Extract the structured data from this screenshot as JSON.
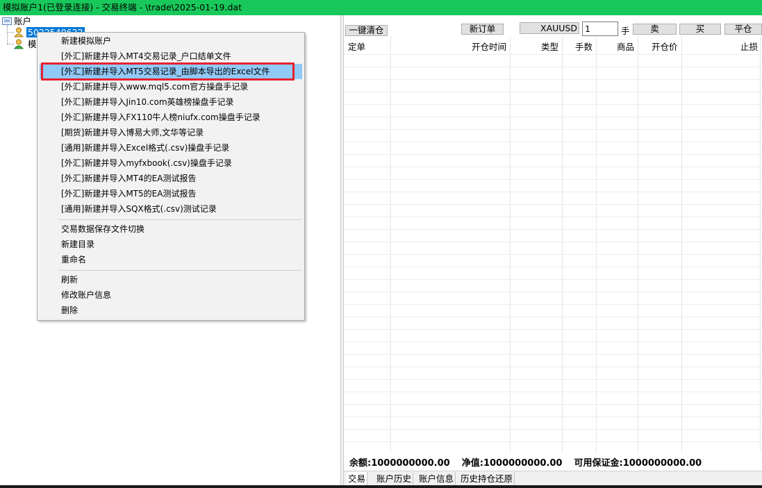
{
  "window": {
    "title": "模拟账户1(已登录连接)  - 交易终端 - \\trade\\2025-01-19.dat"
  },
  "tree": {
    "root_label": "账户",
    "account1_label": "5022540622",
    "account2_label": "模"
  },
  "context_menu": {
    "items": [
      "新建模拟账户",
      "[外汇]新建并导入MT4交易记录_户口结单文件",
      "[外汇]新建并导入MT5交易记录_由脚本导出的Excel文件",
      "[外汇]新建并导入www.mql5.com官方操盘手记录",
      "[外汇]新建并导入Jin10.com英雄榜操盘手记录",
      "[外汇]新建并导入FX110牛人榜niufx.com操盘手记录",
      "[期货]新建并导入博易大师,文华等记录",
      "[通用]新建并导入Excel格式(.csv)操盘手记录",
      "[外汇]新建并导入myfxbook(.csv)操盘手记录",
      "[外汇]新建并导入MT4的EA测试报告",
      "[外汇]新建并导入MT5的EA测试报告",
      "[通用]新建并导入SQX格式(.csv)测试记录",
      "交易数据保存文件切换",
      "新建目录",
      "重命名",
      "刷新",
      "修改账户信息",
      "删除"
    ],
    "highlighted_index": 2
  },
  "toolbar": {
    "close_all_label": "一键清仓",
    "new_order_label": "新订单",
    "symbol": "XAUUSD",
    "lots_value": "1",
    "lots_unit": "手",
    "sell_label": "卖",
    "buy_label": "买",
    "close_label": "平仓"
  },
  "grid": {
    "columns": [
      "定单",
      "开仓时间",
      "类型",
      "手数",
      "商品",
      "开仓价",
      "止损"
    ]
  },
  "status": {
    "balance_label": "余额:",
    "balance_value": "1000000000.00",
    "equity_label": "净值:",
    "equity_value": "1000000000.00",
    "margin_label": "可用保证金:",
    "margin_value": "1000000000.00"
  },
  "tabs": [
    "交易",
    "账户历史",
    "账户信息",
    "历史持仓还原"
  ],
  "colors": {
    "titlebar": "#18c85a",
    "menu_highlight": "#91c9f7",
    "callout_border": "#e8202c",
    "selection": "#0078d7"
  }
}
